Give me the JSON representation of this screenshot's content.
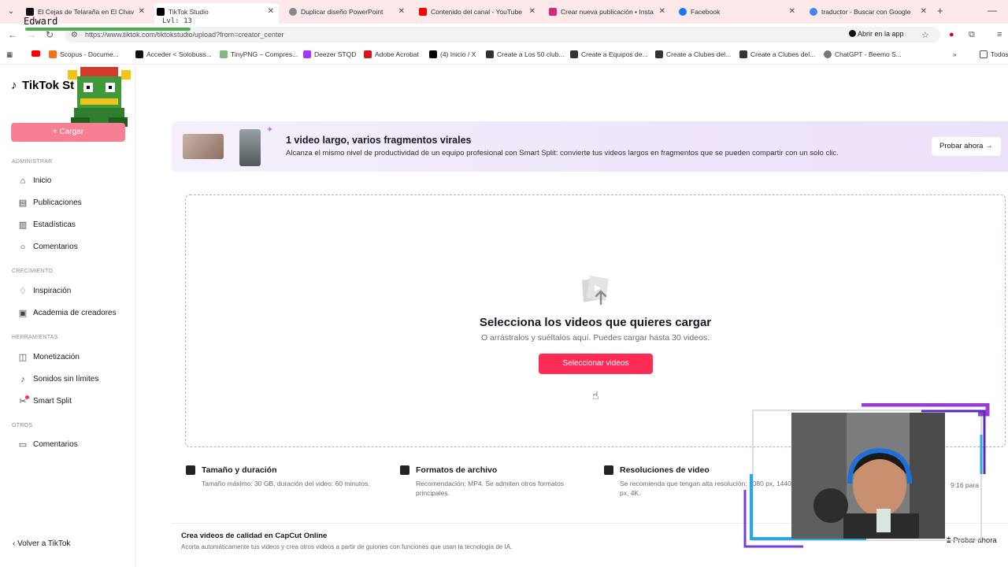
{
  "browser": {
    "tabs": [
      {
        "title": "El Cejas de Telaraña en El Chav",
        "color": "#111111",
        "active": false
      },
      {
        "title": "TikTok Studio",
        "color": "#000000",
        "active": true
      },
      {
        "title": "Duplicar diseño PowerPoint",
        "color": "#888888",
        "active": false
      },
      {
        "title": "Contenido del canal - YouTube",
        "color": "#ff0000",
        "active": false
      },
      {
        "title": "Crear nueva publicación • Insta",
        "color": "#d62976",
        "active": false
      },
      {
        "title": "Facebook",
        "color": "#1877f2",
        "active": false
      },
      {
        "title": "traductor - Buscar con Google",
        "color": "#4285f4",
        "active": false
      }
    ],
    "url": "https://www.tiktok.com/tiktokstudio/upload?from=creator_center",
    "open_app_label": "Abrir en la app",
    "bookmarks": [
      {
        "label": "Scopus - Docume...",
        "color": "#f37021"
      },
      {
        "label": "Acceder < Solobuss...",
        "color": "#111111"
      },
      {
        "label": "TinyPNG – Compres...",
        "color": "#7fb77e"
      },
      {
        "label": "Deezer STQD",
        "color": "#a238ff"
      },
      {
        "label": "Adobe Acrobat",
        "color": "#d4151a"
      },
      {
        "label": "(4) Inicio / X",
        "color": "#000000"
      },
      {
        "label": "Create a Los 50 club...",
        "color": "#333333"
      },
      {
        "label": "Create a Equipos de...",
        "color": "#333333"
      },
      {
        "label": "Create a Clubes del...",
        "color": "#333333"
      },
      {
        "label": "Create a Clubes del...",
        "color": "#333333"
      },
      {
        "label": "ChatGPT - Beemo S...",
        "color": "#777777"
      }
    ],
    "all_bookmarks_label": "Todos"
  },
  "overlay": {
    "name": "Edward",
    "level": "Lvl: 13"
  },
  "sidebar": {
    "logo": "TikTok St",
    "upload_label": "+ Cargar",
    "sections": [
      {
        "title": "ADMINISTRAR",
        "items": [
          "Inicio",
          "Publicaciones",
          "Estadísticas",
          "Comentarios"
        ]
      },
      {
        "title": "CRECIMIENTO",
        "items": [
          "Inspiración",
          "Academia de creadores"
        ]
      },
      {
        "title": "HERRAMIENTAS",
        "items": [
          "Monetización",
          "Sonidos sin límites",
          "Smart Split"
        ]
      },
      {
        "title": "OTROS",
        "items": [
          "Comentarios"
        ]
      }
    ],
    "back_label": "Volver a TikTok"
  },
  "banner": {
    "title": "1 video largo, varios fragmentos virales",
    "description": "Alcanza el mismo nivel de productividad de un equipo profesional con Smart Split: convierte tus videos largos en fragmentos que se pueden compartir con un solo clic.",
    "button": "Probar ahora →"
  },
  "dropzone": {
    "title": "Selecciona los videos que quieres cargar",
    "subtitle": "O arrástralos y suéltalos aquí. Puedes cargar hasta 30 videos.",
    "button": "Seleccionar videos"
  },
  "info": [
    {
      "title": "Tamaño y duración",
      "desc": "Tamaño máximo: 30 GB, duración del video: 60 minutos.",
      "icon": "video-camera-icon"
    },
    {
      "title": "Formatos de archivo",
      "desc": "Recomendación: MP4. Se admiten otros formatos principales.",
      "icon": "file-icon"
    },
    {
      "title": "Resoluciones de video",
      "desc": "Se recomienda que tengan alta resolución: 1080 px, 1440 px, 4K.",
      "icon": "resolution-icon"
    }
  ],
  "info_right_fragment": "9:16 para",
  "capcut": {
    "title": "Crea videos de calidad en CapCut Online",
    "description": "Acorta automáticamente tus videos y crea otros videos a partir de guiones con funciones que usan la tecnología de IA.",
    "button": "Probar ahora"
  }
}
